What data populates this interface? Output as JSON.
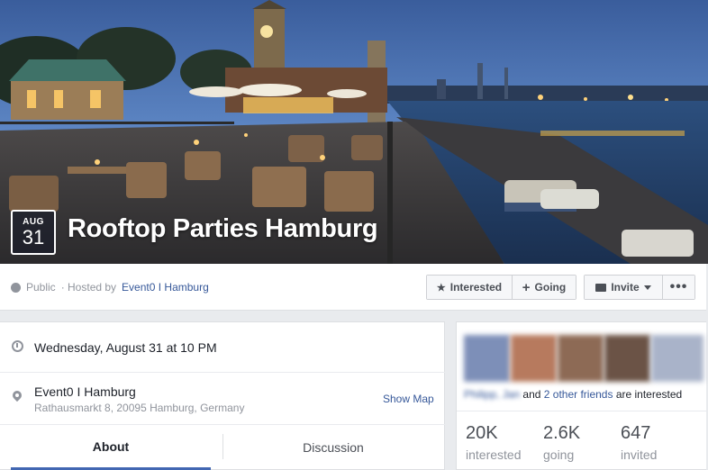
{
  "cover": {
    "month": "AUG",
    "day": "31",
    "title": "Rooftop Parties Hamburg"
  },
  "action_bar": {
    "visibility": "Public",
    "hosted_by_prefix": "· Hosted by",
    "host": "Event0 I Hamburg",
    "interested_label": "Interested",
    "going_label": "Going",
    "invite_label": "Invite",
    "more_label": "•••"
  },
  "details": {
    "datetime": "Wednesday, August 31 at 10 PM",
    "location_name": "Event0 I Hamburg",
    "location_address": "Rathausmarkt 8, 20095 Hamburg, Germany",
    "show_map": "Show Map"
  },
  "tabs": {
    "about": "About",
    "discussion": "Discussion"
  },
  "friends": {
    "blurred_name": "Philipp, Jan",
    "and": "and",
    "others_link": "2 other friends",
    "suffix": "are interested"
  },
  "stats": [
    {
      "value": "20K",
      "label": "interested"
    },
    {
      "value": "2.6K",
      "label": "going"
    },
    {
      "value": "647",
      "label": "invited"
    }
  ]
}
